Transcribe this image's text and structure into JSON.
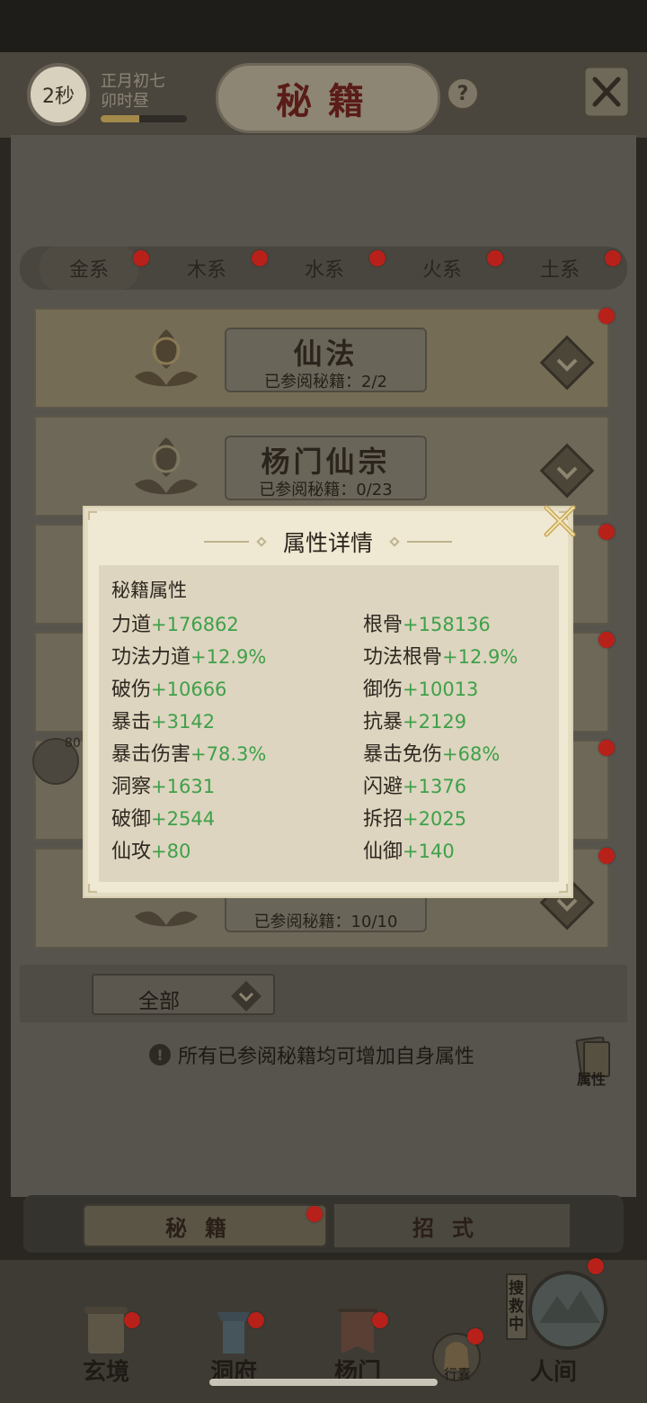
{
  "header": {
    "timer": "2秒",
    "timer_progress": 0.45,
    "date_line1": "正月初七",
    "date_line2": "卯时昼",
    "title": "秘籍",
    "help": "?"
  },
  "tabs": [
    {
      "label": "金系",
      "active": true
    },
    {
      "label": "木系",
      "active": false
    },
    {
      "label": "水系",
      "active": false
    },
    {
      "label": "火系",
      "active": false
    },
    {
      "label": "土系",
      "active": false
    }
  ],
  "sections": [
    {
      "name": "仙法",
      "progress": "已参阅秘籍：2/2"
    },
    {
      "name": "杨门仙宗",
      "progress": "已参阅秘籍：0/23"
    },
    {
      "name": "",
      "progress": "已参阅秘籍：10/10"
    }
  ],
  "chat_count": "80",
  "filter": {
    "label": "全部"
  },
  "hint": "所有已参阅秘籍均可增加自身属性",
  "attr_badge": "属性",
  "bottom_tabs": [
    {
      "label": "秘籍",
      "active": true
    },
    {
      "label": "招式",
      "active": false
    }
  ],
  "nav": [
    {
      "label": "玄境",
      "icon": "scroll-icon"
    },
    {
      "label": "洞府",
      "icon": "lantern-icon"
    },
    {
      "label": "杨门",
      "icon": "banner-icon"
    },
    {
      "label": "行囊",
      "icon": "bag-icon"
    },
    {
      "label": "人间",
      "icon": "world-icon",
      "badge": "搜救中"
    }
  ],
  "modal": {
    "title": "属性详情",
    "section": "秘籍属性",
    "stats_left": [
      {
        "name": "力道",
        "value": "+176862"
      },
      {
        "name": "功法力道",
        "value": "+12.9%"
      },
      {
        "name": "破伤",
        "value": "+10666"
      },
      {
        "name": "暴击",
        "value": "+3142"
      },
      {
        "name": "暴击伤害",
        "value": "+78.3%"
      },
      {
        "name": "洞察",
        "value": "+1631"
      },
      {
        "name": "破御",
        "value": "+2544"
      },
      {
        "name": "仙攻",
        "value": "+80"
      }
    ],
    "stats_right": [
      {
        "name": "根骨",
        "value": "+158136"
      },
      {
        "name": "功法根骨",
        "value": "+12.9%"
      },
      {
        "name": "御伤",
        "value": "+10013"
      },
      {
        "name": "抗暴",
        "value": "+2129"
      },
      {
        "name": "暴击免伤",
        "value": "+68%"
      },
      {
        "name": "闪避",
        "value": "+1376"
      },
      {
        "name": "拆招",
        "value": "+2025"
      },
      {
        "name": "仙御",
        "value": "+140"
      }
    ]
  },
  "colors": {
    "stat_value": "#3fa04a",
    "notify_dot": "#b8201a",
    "title_red": "#5a1c17"
  }
}
